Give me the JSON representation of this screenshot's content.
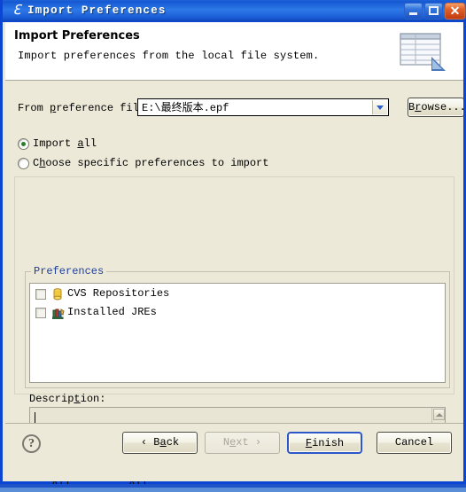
{
  "window": {
    "title": "Import Preferences",
    "app_icon": "eclipse-import-icon",
    "controls": {
      "minimize": "minimize-button",
      "maximize": "maximize-button",
      "close": "close-button",
      "close_glyph": "✕"
    },
    "frame_color": "#0a46d2",
    "titlebar_color": "#1558d2"
  },
  "header": {
    "title": "Import Preferences",
    "description": "Import preferences from the local file system.",
    "icon": "preferences-table-icon"
  },
  "file_row": {
    "label": "From ",
    "label_mnemonic": "p",
    "label_rest": "reference file:",
    "value": "E:\\最终版本.epf",
    "dropdown_icon": "chevron-down-icon",
    "browse": {
      "pre": "B",
      "mnemonic": "r",
      "post": "owse..."
    }
  },
  "options": {
    "import_all": {
      "pre": "Import ",
      "mnemonic": "a",
      "post": "ll",
      "selected": true
    },
    "choose_specific": {
      "pre": "C",
      "mnemonic": "h",
      "post": "oose specific preferences to import",
      "selected": false
    },
    "selected_color": "#2a7e2a"
  },
  "preferences_group": {
    "legend": "Preferences",
    "legend_color": "#20409a",
    "items": [
      {
        "label": "CVS Repositories",
        "checked": false,
        "icon": "cvs-repository-icon"
      },
      {
        "label": "Installed JREs",
        "checked": false,
        "icon": "installed-jres-icon"
      }
    ]
  },
  "description_area": {
    "label_pre": "Descrip",
    "label_mnemonic": "t",
    "label_post": "ion:",
    "value": "",
    "scrollbar": {
      "up": "scroll-up-arrow",
      "down": "scroll-down-arrow"
    }
  },
  "selection_buttons": {
    "select_all": {
      "pre": "S",
      "mnemonic": "e",
      "post": "lect All"
    },
    "deselect_all": {
      "pre": "",
      "mnemonic": "D",
      "post": "eselect All"
    }
  },
  "footer": {
    "help_icon": "help-question-icon",
    "help_glyph": "?",
    "back": {
      "pre": "‹ B",
      "mnemonic": "a",
      "post": "ck",
      "enabled": true
    },
    "next": {
      "pre": "N",
      "mnemonic": "e",
      "post": "xt ›",
      "enabled": false
    },
    "finish": {
      "pre": "",
      "mnemonic": "F",
      "post": "inish",
      "enabled": true,
      "default": true
    },
    "cancel": {
      "pre": "Cancel",
      "mnemonic": "",
      "post": "",
      "enabled": true
    }
  }
}
